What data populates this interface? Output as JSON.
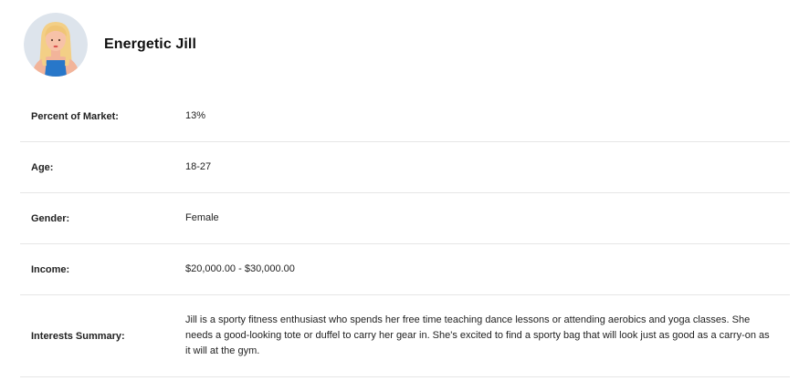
{
  "persona": {
    "name": "Energetic Jill",
    "avatar_icon": "woman-blonde-avatar-icon"
  },
  "attributes": [
    {
      "label": "Percent of Market:",
      "value": "13%"
    },
    {
      "label": "Age:",
      "value": "18-27"
    },
    {
      "label": "Gender:",
      "value": "Female"
    },
    {
      "label": "Income:",
      "value": "$20,000.00 - $30,000.00"
    },
    {
      "label": "Interests Summary:",
      "value": "Jill is a sporty fitness enthusiast who spends her free time teaching dance lessons or attending aerobics and yoga classes. She needs a good-looking tote or duffel to carry her gear in. She's excited to find a sporty bag that will look just as good as a carry-on as it will at the gym."
    }
  ]
}
